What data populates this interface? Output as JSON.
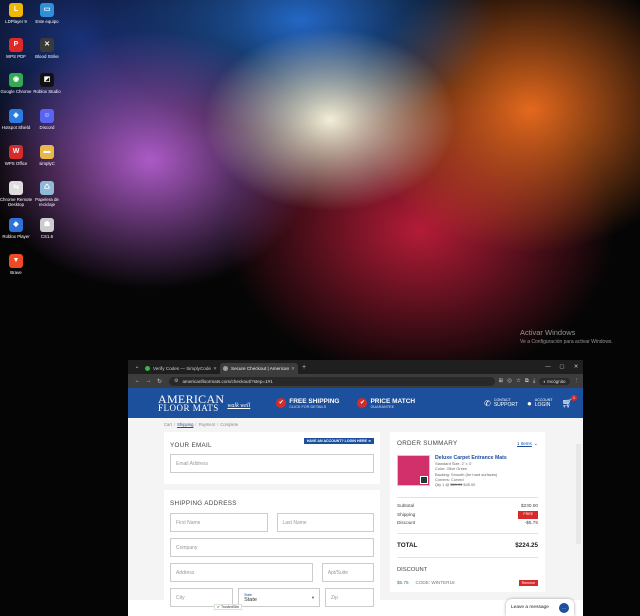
{
  "desktop": {
    "icons": [
      {
        "label": "LDPlayer 9",
        "icon": "ldplayer-icon",
        "color": "#f2b705",
        "glyph": "L"
      },
      {
        "label": "Este equipo",
        "icon": "monitor-icon",
        "color": "#2f8fd8",
        "glyph": "▭"
      },
      {
        "label": "WPS PDF",
        "icon": "wps-pdf-icon",
        "color": "#e02828",
        "glyph": "P"
      },
      {
        "label": "Blood Strike",
        "icon": "blood-strike-icon",
        "color": "#3a3a3a",
        "glyph": "✕"
      },
      {
        "label": "Google Chrome",
        "icon": "chrome-icon",
        "color": "#34a853",
        "glyph": "◉"
      },
      {
        "label": "Roblox Studio",
        "icon": "roblox-studio-icon",
        "color": "#111111",
        "glyph": "◩"
      },
      {
        "label": "Hotspot Shield",
        "icon": "hotspot-shield-icon",
        "color": "#2a7be4",
        "glyph": "◈"
      },
      {
        "label": "Discord",
        "icon": "discord-icon",
        "color": "#5865f2",
        "glyph": "☺"
      },
      {
        "label": "WPS Office",
        "icon": "wps-office-icon",
        "color": "#d62b2b",
        "glyph": "W"
      },
      {
        "label": "simplyC",
        "icon": "folder-icon",
        "color": "#e8b84a",
        "glyph": "▬"
      },
      {
        "label": "Chrome Remote Desktop",
        "icon": "chrome-remote-desktop-icon",
        "color": "#dddddd",
        "glyph": "⇆"
      },
      {
        "label": "Papelera de reciclaje",
        "icon": "recycle-bin-icon",
        "color": "#8fb9d9",
        "glyph": "♺"
      },
      {
        "label": "Roblox Player",
        "icon": "roblox-player-icon",
        "color": "#2c72d9",
        "glyph": "◆"
      },
      {
        "label": "CS1.6",
        "icon": "cs16-icon",
        "color": "#cccccc",
        "glyph": "☗"
      },
      {
        "label": "Brave",
        "icon": "brave-icon",
        "color": "#f04a24",
        "glyph": "▼"
      }
    ],
    "activation": {
      "title": "Activar Windows",
      "subtitle": "Ve a Configuración para activar Windows."
    }
  },
  "browser": {
    "tabs": [
      {
        "label": "Verify Codes — SimplyCodes",
        "favicon_color": "#3ab54a",
        "active": false
      },
      {
        "label": "Secure Checkout | American Fl...",
        "favicon_color": "#9e9e9e",
        "active": true
      }
    ],
    "url": "americanfloormats.com/checkout/?step=1#1",
    "profile": "Incógnito"
  },
  "site": {
    "logo_line1": "AMERICAN",
    "logo_line2": "FLOOR MATS",
    "tagline": "walk well",
    "badges": [
      {
        "title": "FREE SHIPPING",
        "sub": "CLICK FOR DETAILS"
      },
      {
        "title": "PRICE MATCH",
        "sub": "GUARANTEE"
      }
    ],
    "contact": {
      "small": "CONTACT",
      "big": "SUPPORT"
    },
    "account": {
      "small": "ACCOUNT",
      "big": "LOGIN"
    },
    "cart_count": "1"
  },
  "checkout": {
    "breadcrumbs": [
      "Cart",
      "Shipping",
      "Payment",
      "Complete"
    ],
    "email": {
      "title": "YOUR EMAIL",
      "have_account": "HAVE AN ACCOUNT? LOGIN HERE ➜",
      "placeholder": "Email Address"
    },
    "shipping": {
      "title": "SHIPPING ADDRESS",
      "first_name": "First Name",
      "last_name": "Last Name",
      "company": "Company",
      "address": "Address",
      "apt": "Apt/Suite",
      "city": "City",
      "state_label": "State",
      "state_value": "State",
      "zip": "Zip"
    },
    "trusted_site": "TrustedSite"
  },
  "order_summary": {
    "title": "ORDER SUMMARY",
    "items_link": "1 Items",
    "product": {
      "name": "Deluxe Carpet Entrance Mats",
      "size": "Standard Size: 2' x 3'",
      "color": "Color: Olive Green",
      "backing": "Backing: Smooth (for hard surfaces)",
      "corners": "Corners: Curved",
      "qty_prefix": "Qty 1 @",
      "old_price": "$69.99",
      "new_price": "$45.00",
      "image_color": "#d1306b"
    },
    "subtotal_label": "Subtotal",
    "subtotal": "$230.00",
    "shipping_label": "Shipping",
    "shipping_value": "FREE",
    "discount_label": "Discount",
    "discount_value": "-$5.75",
    "total_label": "TOTAL",
    "total": "$224.25",
    "discount_section_title": "DISCOUNT",
    "discount_amount": "$5.75",
    "discount_code": "CODE: WINTER18",
    "remove_label": "Remove"
  },
  "livechat": {
    "label": "Leave a message"
  }
}
